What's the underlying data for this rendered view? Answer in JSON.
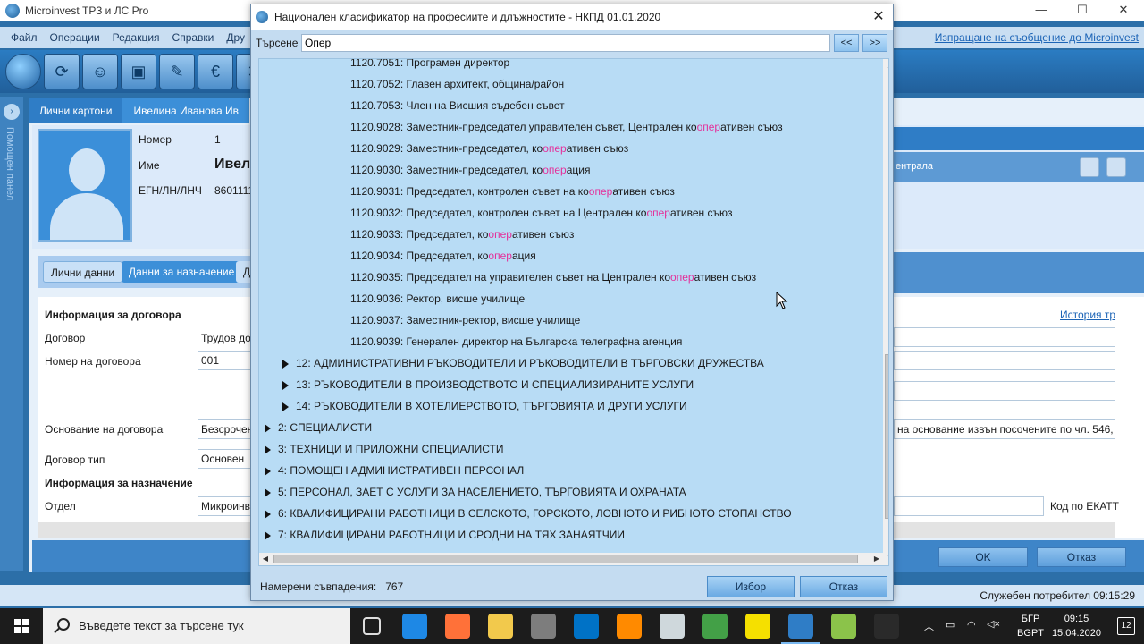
{
  "app": {
    "title": "Microinvest ТРЗ и ЛС Pro",
    "controls": {
      "minimize": "—",
      "maximize": "☐",
      "close": "✕"
    }
  },
  "menu": {
    "items": [
      "Файл",
      "Операции",
      "Редакция",
      "Справки",
      "Дру"
    ],
    "right_link": "Изпращане на съобщение до Microinvest"
  },
  "help_panel": {
    "label": "Помощен панел",
    "arrow": "›"
  },
  "background": {
    "tabs": [
      "Лични картони",
      "Ивелина Иванова Ив"
    ],
    "profile": {
      "number_label": "Номер",
      "number_value": "1",
      "name_label": "Име",
      "name_value": "Ивел",
      "egn_label": "ЕГН/ЛН/ЛНЧ",
      "egn_value": "8601111"
    },
    "subtabs": [
      "Лични данни",
      "Данни за назначение",
      "Да"
    ],
    "form": {
      "contract_info": "Информация за договора",
      "contract_label": "Договор",
      "contract_value": "Трудов до",
      "contract_no_label": "Номер на договора",
      "contract_no_value": "001",
      "basis_label": "Основание на договора",
      "basis_value": "Безсрочен",
      "type_label": "Договор тип",
      "type_value": "Основен",
      "assign_info": "Информация за назначение",
      "dept_label": "Отдел",
      "dept_value": "Микроинве",
      "right_basis_text": "на основание извън посочените по чл. 546,",
      "ekatte_label": "Код по ЕКАТТ",
      "history_link": "История тр",
      "right_row_text": "ентрала"
    },
    "buttons": {
      "ok": "OK",
      "cancel": "Отказ"
    },
    "status": "Служебен потребител   09:15:29"
  },
  "dialog": {
    "title": "Национален класификатор на професиите и длъжностите - НКПД 01.01.2020",
    "close": "✕",
    "search_label": "Търсене",
    "search_value": "Опер",
    "prev": "<<",
    "next": ">>",
    "rows": [
      {
        "indent": 3,
        "parts": [
          "1120.7051: Програмен директор"
        ]
      },
      {
        "indent": 3,
        "parts": [
          "1120.7052: Главен архитект, община/район"
        ]
      },
      {
        "indent": 3,
        "parts": [
          "1120.7053: Член на Висшия съдебен съвет"
        ]
      },
      {
        "indent": 3,
        "parts": [
          "1120.9028: Заместник-председател управителен съвет, Централен ко",
          "опер",
          "ативен съюз"
        ]
      },
      {
        "indent": 3,
        "parts": [
          "1120.9029: Заместник-председател, ко",
          "опер",
          "ативен съюз"
        ]
      },
      {
        "indent": 3,
        "parts": [
          "1120.9030: Заместник-председател, ко",
          "опер",
          "ация"
        ]
      },
      {
        "indent": 3,
        "parts": [
          "1120.9031: Председател, контролен съвет на ко",
          "опер",
          "ативен съюз"
        ]
      },
      {
        "indent": 3,
        "parts": [
          "1120.9032: Председател, контролен съвет на Централен ко",
          "опер",
          "ативен съюз"
        ]
      },
      {
        "indent": 3,
        "parts": [
          "1120.9033: Председател, ко",
          "опер",
          "ативен съюз"
        ]
      },
      {
        "indent": 3,
        "parts": [
          "1120.9034: Председател, ко",
          "опер",
          "ация"
        ]
      },
      {
        "indent": 3,
        "parts": [
          "1120.9035: Председател на управителен съвет на Централен ко",
          "опер",
          "ативен съюз"
        ]
      },
      {
        "indent": 3,
        "parts": [
          "1120.9036: Ректор, висше училище"
        ]
      },
      {
        "indent": 3,
        "parts": [
          "1120.9037: Заместник-ректор, висше училище"
        ]
      },
      {
        "indent": 3,
        "parts": [
          "1120.9039: Генерален директор на Българска телеграфна агенция"
        ]
      },
      {
        "indent": 1,
        "expand": true,
        "parts": [
          "12: АДМИНИСТРАТИВНИ РЪКОВОДИТЕЛИ И РЪКОВОДИТЕЛИ В ТЪРГОВСКИ ДРУЖЕСТВА"
        ]
      },
      {
        "indent": 1,
        "expand": true,
        "parts": [
          "13: РЪКОВОДИТЕЛИ В ПРОИЗВОДСТВОТО И СПЕЦИАЛИЗИРАНИТЕ УСЛУГИ"
        ]
      },
      {
        "indent": 1,
        "expand": true,
        "parts": [
          "14: РЪКОВОДИТЕЛИ В ХОТЕЛИЕРСТВОТО, ТЪРГОВИЯТА И ДРУГИ УСЛУГИ"
        ]
      },
      {
        "indent": 0,
        "expand": true,
        "parts": [
          "2: СПЕЦИАЛИСТИ"
        ]
      },
      {
        "indent": 0,
        "expand": true,
        "parts": [
          "3: ТЕХНИЦИ И ПРИЛОЖНИ СПЕЦИАЛИСТИ"
        ]
      },
      {
        "indent": 0,
        "expand": true,
        "parts": [
          "4: ПОМОЩЕН АДМИНИСТРАТИВЕН  ПЕРСОНАЛ"
        ]
      },
      {
        "indent": 0,
        "expand": true,
        "parts": [
          "5: ПЕРСОНАЛ, ЗАЕТ С УСЛУГИ ЗА НАСЕЛЕНИЕТО, ТЪРГОВИЯТА И ОХРАНАТА"
        ]
      },
      {
        "indent": 0,
        "expand": true,
        "parts": [
          "6: КВАЛИФИЦИРАНИ РАБОТНИЦИ В СЕЛСКОТО, ГОРСКОТО, ЛОВНОТО И РИБНОТО СТОПАНСТВО"
        ]
      },
      {
        "indent": 0,
        "expand": true,
        "parts": [
          "7: КВАЛИФИЦИРАНИ РАБОТНИЦИ И СРОДНИ НА ТЯХ ЗАНАЯТЧИИ"
        ]
      }
    ],
    "highlight_color": "#e4309a",
    "matches_label": "Намерени съвпадения:",
    "matches_value": "767",
    "select_button": "Избор",
    "cancel_button": "Отказ"
  },
  "taskbar": {
    "search_placeholder": "Въведете текст за търсене тук",
    "lang": "БГР\nBGPT",
    "lang_top": "БГР",
    "lang_bottom": "BGPT",
    "time": "09:15",
    "date": "15.04.2020",
    "notifications": "12",
    "apps": [
      "task-view-icon",
      "edge-icon",
      "firefox-icon",
      "file-explorer-icon",
      "calculator-icon",
      "outlook-icon",
      "burn-icon",
      "snip-icon",
      "arrow-app-icon",
      "sticky-notes-icon",
      "microinvest-icon",
      "green-app-icon",
      "drive-icon"
    ]
  }
}
